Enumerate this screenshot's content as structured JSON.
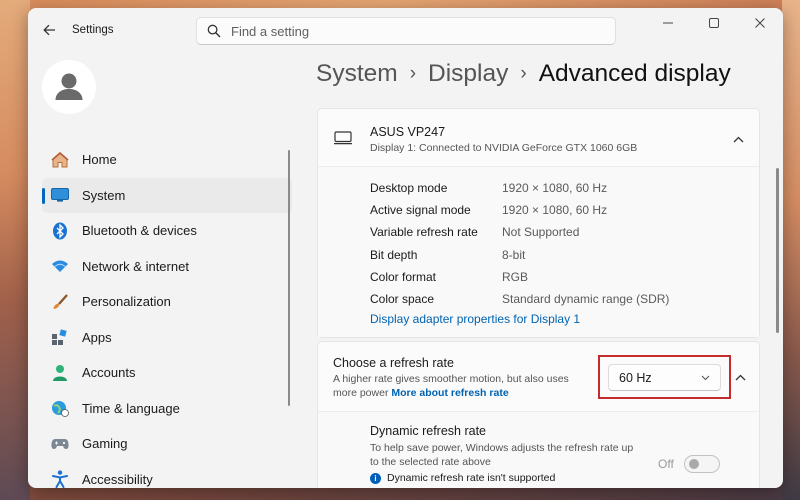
{
  "window": {
    "app_title": "Settings",
    "search_placeholder": "Find a setting"
  },
  "sidebar": {
    "items": [
      {
        "label": "Home",
        "icon": "home-icon"
      },
      {
        "label": "System",
        "icon": "system-icon",
        "active": true
      },
      {
        "label": "Bluetooth & devices",
        "icon": "bluetooth-icon"
      },
      {
        "label": "Network & internet",
        "icon": "wifi-icon"
      },
      {
        "label": "Personalization",
        "icon": "brush-icon"
      },
      {
        "label": "Apps",
        "icon": "apps-icon"
      },
      {
        "label": "Accounts",
        "icon": "accounts-icon"
      },
      {
        "label": "Time & language",
        "icon": "globe-icon"
      },
      {
        "label": "Gaming",
        "icon": "gamepad-icon"
      },
      {
        "label": "Accessibility",
        "icon": "accessibility-icon"
      }
    ]
  },
  "breadcrumb": {
    "level1": "System",
    "level2": "Display",
    "current": "Advanced display",
    "separator": "›"
  },
  "display_card": {
    "name": "ASUS VP247",
    "subtitle": "Display 1: Connected to NVIDIA GeForce GTX 1060 6GB",
    "properties": [
      {
        "key": "Desktop mode",
        "value": "1920 × 1080, 60 Hz"
      },
      {
        "key": "Active signal mode",
        "value": "1920 × 1080, 60 Hz"
      },
      {
        "key": "Variable refresh rate",
        "value": "Not Supported"
      },
      {
        "key": "Bit depth",
        "value": "8-bit"
      },
      {
        "key": "Color format",
        "value": "RGB"
      },
      {
        "key": "Color space",
        "value": "Standard dynamic range (SDR)"
      }
    ],
    "adapter_link": "Display adapter properties for Display 1"
  },
  "refresh_card": {
    "title": "Choose a refresh rate",
    "description": "A higher rate gives smoother motion, but also uses more power",
    "learn_more": "More about refresh rate",
    "selected_rate": "60 Hz",
    "dynamic": {
      "title": "Dynamic refresh rate",
      "description": "To help save power, Windows adjusts the refresh rate up to the selected rate above",
      "note": "Dynamic refresh rate isn't supported",
      "toggle_label": "Off"
    }
  },
  "colors": {
    "accent": "#0067c0",
    "highlight": "#c42b2b"
  }
}
